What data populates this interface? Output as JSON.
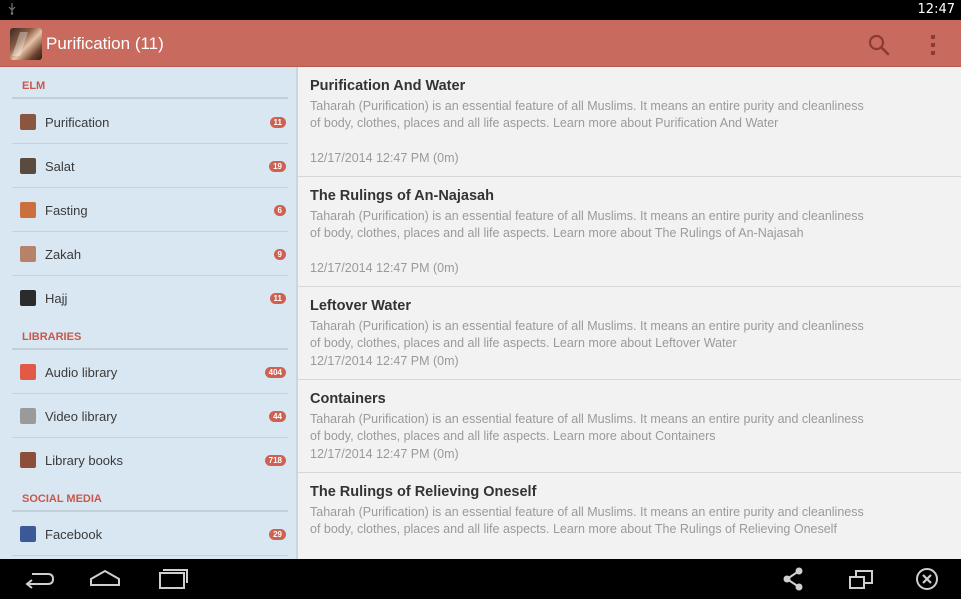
{
  "status_bar": {
    "time": "12:47",
    "usb_icon": "usb-icon"
  },
  "action_bar": {
    "title": "Purification (11)",
    "search_icon": "search-icon",
    "overflow_icon": "overflow-menu-icon"
  },
  "drawer": {
    "sections": [
      {
        "label": "ELM"
      },
      {
        "label": "LIBRARIES"
      },
      {
        "label": "SOCIAL MEDIA"
      }
    ],
    "items": [
      {
        "label": "Purification",
        "badge": "11",
        "icon": "purification-icon",
        "icon_color": "#8a5640"
      },
      {
        "label": "Salat",
        "badge": "19",
        "icon": "salat-icon",
        "icon_color": "#5b4a3e"
      },
      {
        "label": "Fasting",
        "badge": "6",
        "icon": "fasting-icon",
        "icon_color": "#c9703e"
      },
      {
        "label": "Zakah",
        "badge": "9",
        "icon": "zakah-icon",
        "icon_color": "#b7826a"
      },
      {
        "label": "Hajj",
        "badge": "11",
        "icon": "kaaba-icon",
        "icon_color": "#2b2b2b"
      },
      {
        "label": "Audio library",
        "badge": "404",
        "icon": "audio-library-icon",
        "icon_color": "#e05a47"
      },
      {
        "label": "Video library",
        "badge": "44",
        "icon": "video-library-icon",
        "icon_color": "#9a9a9a"
      },
      {
        "label": "Library books",
        "badge": "718",
        "icon": "library-books-icon",
        "icon_color": "#8a4e3b"
      },
      {
        "label": "Facebook",
        "badge": "29",
        "icon": "facebook-icon",
        "icon_color": "#3b5998"
      }
    ]
  },
  "articles": [
    {
      "title": "Purification And Water",
      "description": "Taharah (Purification) is an essential feature of all Muslims. It means an entire purity and cleanliness of body, clothes, places and all life aspects. Learn more about Purification And Water",
      "date": "12/17/2014 12:47 PM (0m)"
    },
    {
      "title": "The Rulings of An-Najasah",
      "description": "Taharah (Purification) is an essential feature of all Muslims. It means an entire purity and cleanliness of body, clothes, places and all life aspects. Learn more about The Rulings of An-Najasah",
      "date": "12/17/2014 12:47 PM (0m)"
    },
    {
      "title": "Leftover Water",
      "description": "Taharah (Purification) is an essential feature of all Muslims. It means an entire purity and cleanliness of body, clothes, places and all life aspects. Learn more about Leftover Water",
      "date": "12/17/2014 12:47 PM (0m)"
    },
    {
      "title": "Containers",
      "description": "Taharah (Purification) is an essential feature of all Muslims. It means an entire purity and cleanliness of body, clothes, places and all life aspects. Learn more about Containers",
      "date": "12/17/2014 12:47 PM (0m)"
    },
    {
      "title": "The Rulings of Relieving Oneself",
      "description": "Taharah (Purification) is an essential feature of all Muslims. It means an entire purity and cleanliness of body, clothes, places and all life aspects. Learn more about The Rulings of Relieving Oneself",
      "date": ""
    }
  ],
  "nav_bar": {
    "back_icon": "back-icon",
    "home_icon": "home-icon",
    "recents_icon": "recent-apps-icon",
    "share_icon": "share-icon",
    "window_icon": "window-icon",
    "close_icon": "close-circle-icon"
  },
  "colors": {
    "action_bar": "#c86a5d",
    "drawer_bg": "#d9e7f3",
    "section_header": "#c8584a",
    "badge": "#d0604f"
  }
}
